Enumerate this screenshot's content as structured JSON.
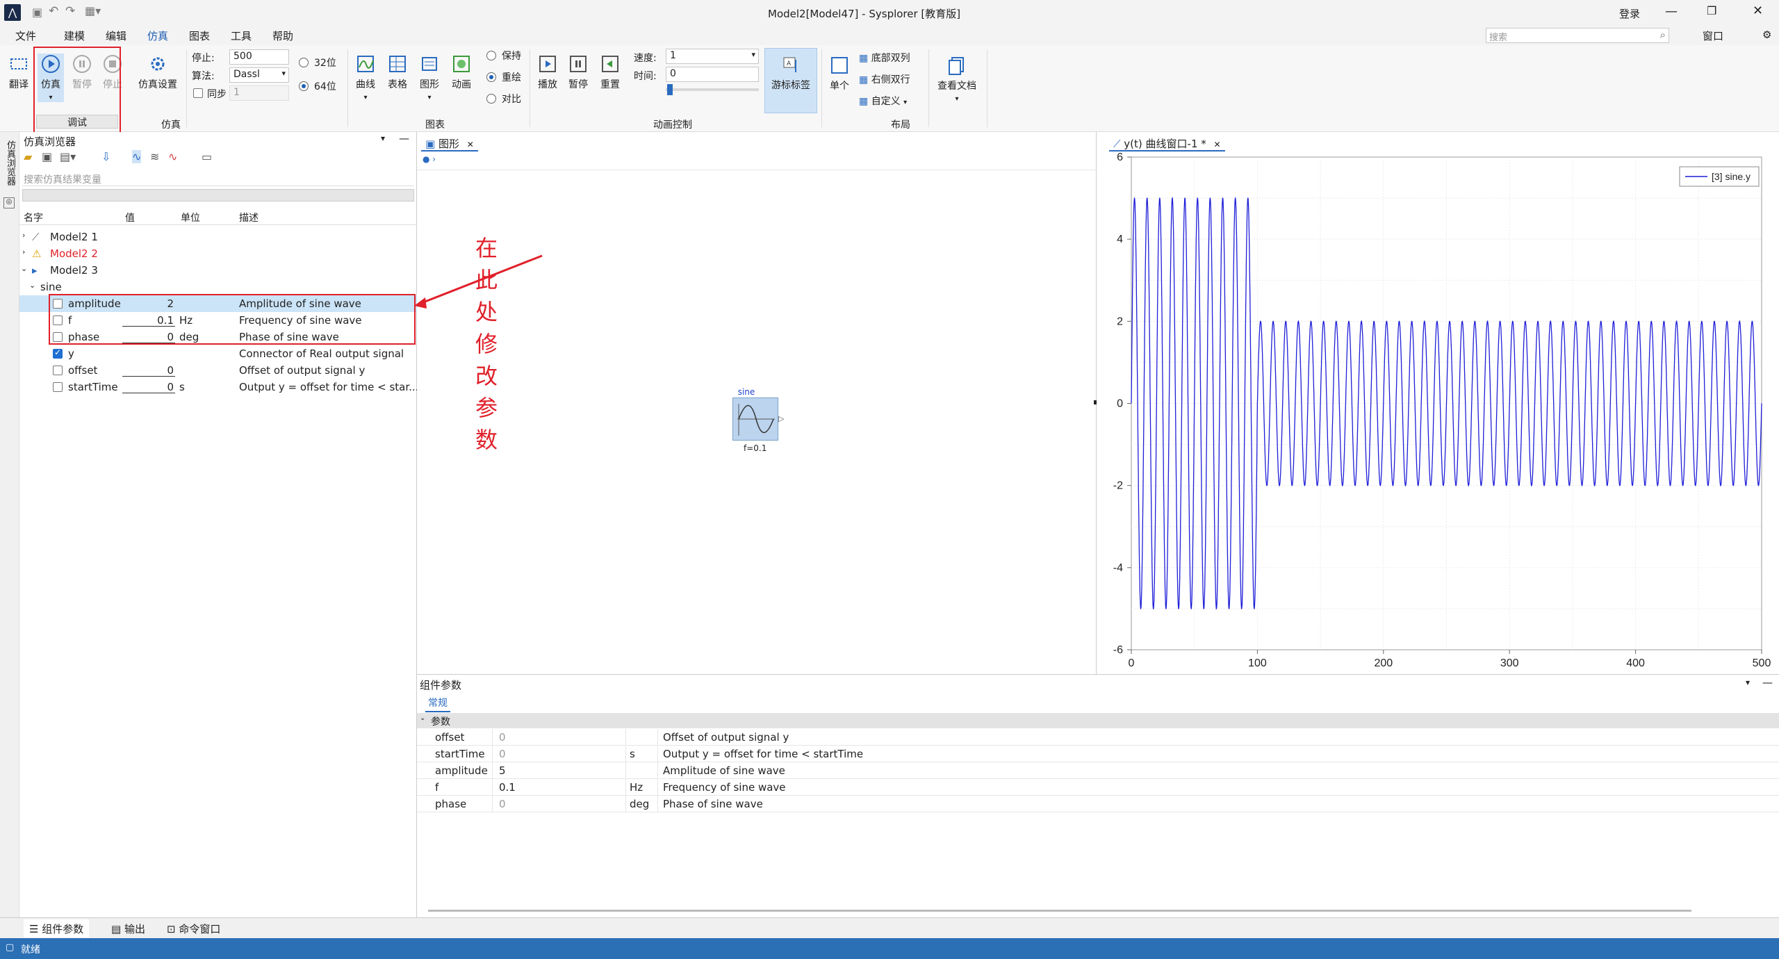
{
  "window": {
    "title": "Model2[Model47] - Sysplorer [教育版]",
    "login": "登录",
    "search_placeholder": "搜索",
    "window_menu": "窗口"
  },
  "menu": [
    "文件",
    "建模",
    "编辑",
    "仿真",
    "图表",
    "工具",
    "帮助"
  ],
  "ribbon": {
    "translate": "翻译",
    "simulate": "仿真",
    "pause": "暂停",
    "stop": "停止",
    "debug": "调试",
    "sim_settings": "仿真设置",
    "group_sim": "仿真",
    "stop_label": "停止:",
    "stop_value": "500",
    "algo_label": "算法:",
    "algo_value": "Dassl",
    "sync_label": "同步",
    "sync_value": "1",
    "bit32": "32位",
    "bit64": "64位",
    "curve": "曲线",
    "table": "表格",
    "figure": "图形",
    "animation": "动画",
    "group_chart": "图表",
    "keep": "保持",
    "redraw": "重绘",
    "compare": "对比",
    "play": "播放",
    "pause_anim": "暂停",
    "reset": "重置",
    "speed_label": "速度:",
    "speed_value": "1",
    "time_label": "时间:",
    "time_value": "0",
    "cursor_label": "游标标签",
    "group_anim": "动画控制",
    "single": "单个",
    "bottom_double": "底部双列",
    "right_double": "右侧双行",
    "custom": "自定义",
    "group_layout": "布局",
    "view_docs": "查看文档"
  },
  "left": {
    "side_tab": "仿真浏览器",
    "panel_title": "仿真浏览器",
    "search_placeholder": "搜索仿真结果变量",
    "headers": [
      "名字",
      "值",
      "单位",
      "描述"
    ],
    "models": [
      {
        "name": "Model2 1"
      },
      {
        "name": "Model2 2"
      },
      {
        "name": "Model2 3"
      }
    ],
    "component": "sine",
    "vars": [
      {
        "name": "amplitude",
        "value": "2",
        "unit": "",
        "desc": "Amplitude of sine wave"
      },
      {
        "name": "f",
        "value": "0.1",
        "unit": "Hz",
        "desc": "Frequency of sine wave"
      },
      {
        "name": "phase",
        "value": "0",
        "unit": "deg",
        "desc": "Phase of sine wave"
      },
      {
        "name": "y",
        "value": "",
        "unit": "",
        "desc": "Connector of Real output signal"
      },
      {
        "name": "offset",
        "value": "0",
        "unit": "",
        "desc": "Offset of output signal y"
      },
      {
        "name": "startTime",
        "value": "0",
        "unit": "s",
        "desc": "Output y = offset for time < star..."
      }
    ],
    "annotation": "在此处修改参数"
  },
  "center": {
    "tab": "图形",
    "block_label": "sine",
    "block_param": "f=0.1"
  },
  "plot": {
    "tab": "y(t) 曲线窗口-1 *",
    "legend": "[3] sine.y"
  },
  "chart_data": {
    "type": "line",
    "series": [
      {
        "name": "[3] sine.y",
        "segments": [
          {
            "x_start": 0,
            "x_end": 100,
            "amplitude": 5,
            "frequency": 0.1
          },
          {
            "x_start": 100,
            "x_end": 500,
            "amplitude": 2,
            "frequency": 0.1
          }
        ]
      }
    ],
    "xlim": [
      0,
      500
    ],
    "ylim": [
      -6,
      6
    ],
    "x_ticks": [
      "0",
      "100",
      "200",
      "300",
      "400",
      "500"
    ],
    "y_ticks": [
      "6",
      "4",
      "2",
      "0",
      "-2",
      "-4",
      "-6"
    ],
    "grid": true,
    "legend_position": "top-right"
  },
  "params": {
    "title": "组件参数",
    "tab": "常规",
    "group": "参数",
    "rows": [
      {
        "name": "offset",
        "value": "0",
        "unit": "",
        "desc": "Offset of output signal y"
      },
      {
        "name": "startTime",
        "value": "0",
        "unit": "s",
        "desc": "Output y = offset for time < startTime"
      },
      {
        "name": "amplitude",
        "value": "5",
        "unit": "",
        "desc": "Amplitude of sine wave"
      },
      {
        "name": "f",
        "value": "0.1",
        "unit": "Hz",
        "desc": "Frequency of sine wave"
      },
      {
        "name": "phase",
        "value": "0",
        "unit": "deg",
        "desc": "Phase of sine wave"
      }
    ]
  },
  "bottom_tabs": [
    "组件参数",
    "输出",
    "命令窗口"
  ],
  "status": "就绪"
}
